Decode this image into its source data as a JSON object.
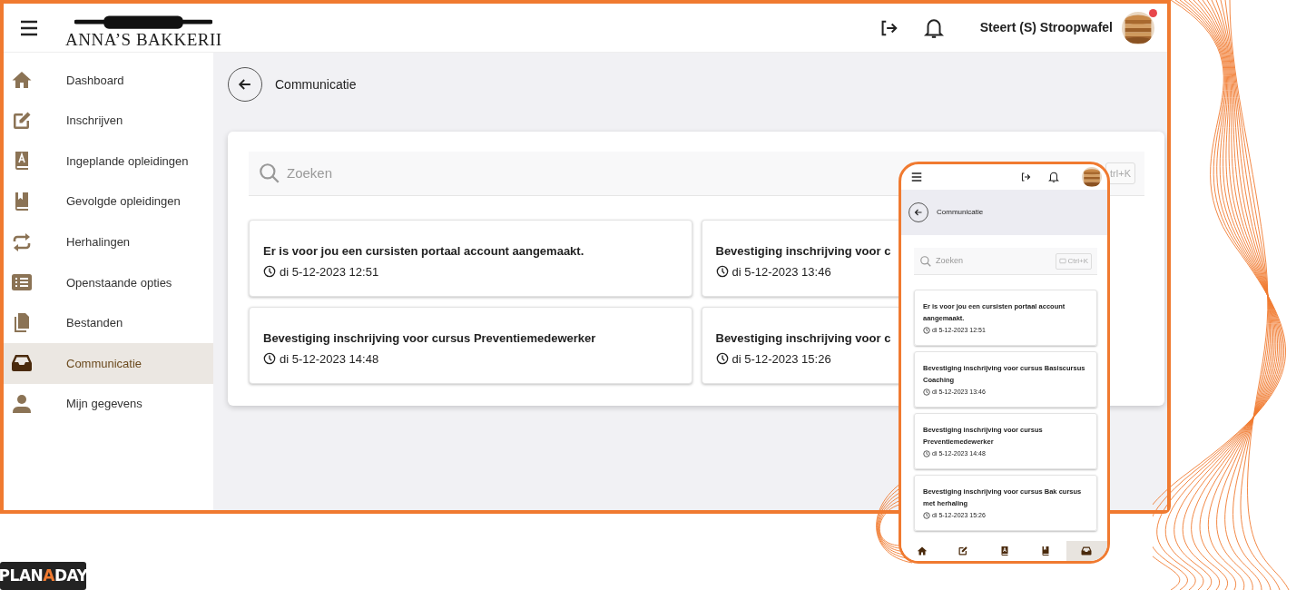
{
  "app": {
    "logo": "ANNA’S BAKKERII",
    "user_name": "Steert (S) Stroopwafel",
    "has_notification": true
  },
  "sidebar": {
    "items": [
      {
        "label": "Dashboard",
        "selected": false
      },
      {
        "label": "Inschrijven",
        "selected": false
      },
      {
        "label": "Ingeplande opleidingen",
        "selected": false
      },
      {
        "label": "Gevolgde opleidingen",
        "selected": false
      },
      {
        "label": "Herhalingen",
        "selected": false
      },
      {
        "label": "Openstaande opties",
        "selected": false
      },
      {
        "label": "Bestanden",
        "selected": false
      },
      {
        "label": "Communicatie",
        "selected": true
      },
      {
        "label": "Mijn gegevens",
        "selected": false
      }
    ]
  },
  "page": {
    "title": "Communicatie",
    "search": {
      "placeholder": "Zoeken",
      "shortcut": "trl+K"
    },
    "messages": [
      {
        "title": "Er is voor jou een cursisten portaal account aangemaakt.",
        "date": "di 5-12-2023 12:51"
      },
      {
        "title": "Bevestiging inschrijving voor c",
        "date": "di 5-12-2023 13:46"
      },
      {
        "title": "Bevestiging inschrijving voor cursus Preventiemedewerker",
        "date": "di 5-12-2023 14:48"
      },
      {
        "title": "Bevestiging inschrijving voor c",
        "date": "di 5-12-2023 15:26"
      }
    ]
  },
  "mobile": {
    "title": "Communicatie",
    "search": {
      "placeholder": "Zoeken",
      "shortcut": "Ctrl+K"
    },
    "messages": [
      {
        "title": "Er is voor jou een cursisten portaal account aangemaakt.",
        "date": "di 5-12-2023 12:51"
      },
      {
        "title": "Bevestiging inschrijving voor cursus Basiscursus Coaching",
        "date": "di 5-12-2023 13:46"
      },
      {
        "title": "Bevestiging inschrijving voor cursus Preventiemedewerker",
        "date": "di 5-12-2023 14:48"
      },
      {
        "title": "Bevestiging inschrijving voor cursus Bak cursus met herhaling",
        "date": "di 5-12-2023 15:26"
      }
    ],
    "bottom_nav": [
      {
        "selected": false
      },
      {
        "selected": false
      },
      {
        "selected": false
      },
      {
        "selected": false
      },
      {
        "selected": true
      }
    ]
  },
  "footer_logo": {
    "parts": [
      "PLAN",
      "A",
      "DAY"
    ]
  }
}
